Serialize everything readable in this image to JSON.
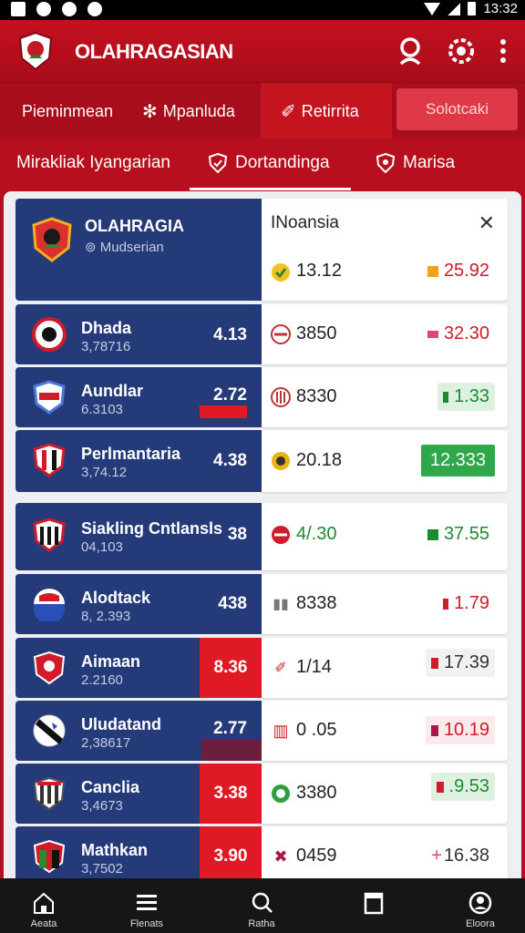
{
  "status_bar": {
    "time": "13:32"
  },
  "app_bar": {
    "title": "OLAHRAGASIAN",
    "icons": [
      "account-icon",
      "settings-icon",
      "more-icon"
    ]
  },
  "tabs_row1": [
    {
      "label": "Pieminmean",
      "icon": ""
    },
    {
      "label": "Mpanluda",
      "icon": "network-icon"
    },
    {
      "label": "Retirrita",
      "icon": "pen-icon",
      "active": true
    }
  ],
  "tabs_row1_button": "Solotcaki",
  "tabs_row2": [
    {
      "label": "Mirakliak Iyangarian",
      "icon": ""
    },
    {
      "label": "Dortandinga",
      "icon": "shield-check-icon",
      "active": true
    },
    {
      "label": "Marisa",
      "icon": "shield-icon"
    }
  ],
  "header_row": {
    "name": "OLAHRAGIA",
    "sub": "⊚ Mudserian",
    "country": "INoansia",
    "left_value": "13.12",
    "right_value": "25.92"
  },
  "rows": [
    {
      "name": "Dhada",
      "sub": "3,78716",
      "odd": "4.13",
      "mid": "3850",
      "right": "32.30"
    },
    {
      "name": "Aundlar",
      "sub": "6.3103",
      "odd": "2.72",
      "mid": "8330",
      "right": "1.33"
    },
    {
      "name": "Perlmantaria",
      "sub": "3,74.12",
      "odd": "4.38",
      "mid": "20.18",
      "right": "12.333"
    },
    {
      "name": "Siakling Cntlansls",
      "sub": "04,103",
      "odd": "38",
      "mid": "4/.30",
      "right": "37.55"
    },
    {
      "name": "Alodtack",
      "sub": "8, 2.393",
      "odd": "438",
      "mid": "8338",
      "right": "1.79"
    },
    {
      "name": "Aimaan",
      "sub": "2.2160",
      "odd": "8.36",
      "mid": "1/14",
      "right": "17.39"
    },
    {
      "name": "Uludatand",
      "sub": "2,38617",
      "odd": "2.77",
      "mid": "0 .05",
      "right": "10.19"
    },
    {
      "name": "Canclia",
      "sub": "3,4673",
      "odd": "3.38",
      "mid": "3380",
      "right": ".9.53"
    },
    {
      "name": "Mathkan",
      "sub": "3,7502",
      "odd": "3.90",
      "mid": "0459",
      "right": "16.38"
    }
  ],
  "bottom_nav": [
    "Aeata",
    "Flenats",
    "Ratha",
    "",
    "Eloora"
  ],
  "colors": {
    "brand_red": "#b50f1f",
    "team_blue": "#253a79",
    "odd_red": "#e01a24",
    "up_green": "#1b8c2e"
  }
}
